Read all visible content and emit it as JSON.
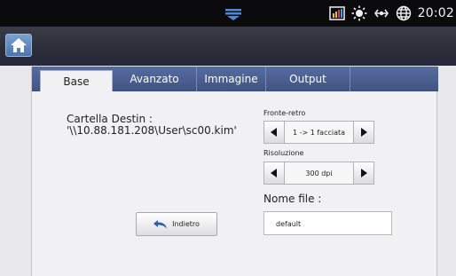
{
  "status_bar": {
    "time": "20:02",
    "icons": [
      "pull-down-handle-icon",
      "signal-bars-icon",
      "brightness-icon",
      "network-icon",
      "globe-icon"
    ]
  },
  "action_bar": {
    "home_icon": "home-icon"
  },
  "tabs": [
    {
      "label": "Base",
      "active": true
    },
    {
      "label": "Avanzato",
      "active": false
    },
    {
      "label": "Immagine",
      "active": false
    },
    {
      "label": "Output",
      "active": false
    }
  ],
  "destination": {
    "label": "Cartella Destin :",
    "path": "'\\\\10.88.181.208\\User\\sc00.kim'"
  },
  "duplex": {
    "label": "Fronte-retro",
    "value": "1 -> 1 facciata"
  },
  "resolution": {
    "label": "Risoluzione",
    "value": "300 dpi"
  },
  "filename": {
    "label": "Nome file :",
    "value": "default"
  },
  "back_button": {
    "label": "Indietro",
    "icon": "undo-arrow-icon"
  },
  "colors": {
    "tab_bar": "#4a5f92",
    "status_bar": "#0b0b0d",
    "action_bar": "#2b2d38",
    "panel": "#f1f1f3"
  }
}
